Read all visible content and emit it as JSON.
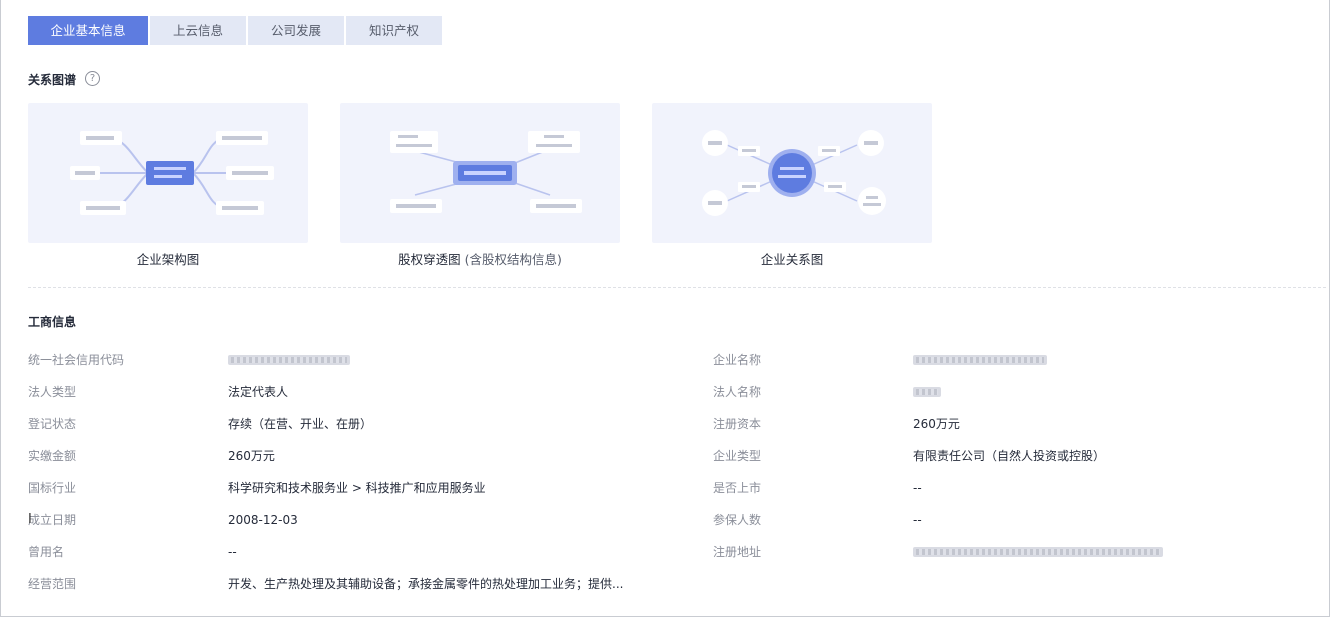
{
  "tabs": [
    {
      "label": "企业基本信息",
      "active": true
    },
    {
      "label": "上云信息",
      "active": false
    },
    {
      "label": "公司发展",
      "active": false
    },
    {
      "label": "知识产权",
      "active": false
    }
  ],
  "relation_section": {
    "title": "关系图谱",
    "help_icon": "?"
  },
  "cards": [
    {
      "caption": "企业架构图",
      "sub": ""
    },
    {
      "caption": "股权穿透图",
      "sub": "(含股权结构信息)"
    },
    {
      "caption": "企业关系图",
      "sub": ""
    }
  ],
  "business_section": {
    "title": "工商信息"
  },
  "left_fields": [
    {
      "label": "统一社会信用代码",
      "value": "",
      "redacted": true
    },
    {
      "label": "法人类型",
      "value": "法定代表人"
    },
    {
      "label": "登记状态",
      "value": "存续（在营、开业、在册）"
    },
    {
      "label": "实缴金额",
      "value": "260万元"
    },
    {
      "label": "国标行业",
      "value": "科学研究和技术服务业 > 科技推广和应用服务业"
    },
    {
      "label": "成立日期",
      "value": "2008-12-03"
    },
    {
      "label": "曾用名",
      "value": "--"
    },
    {
      "label": "经营范围",
      "value": "开发、生产热处理及其辅助设备；承接金属零件的热处理加工业务；提供..."
    }
  ],
  "right_fields": [
    {
      "label": "企业名称",
      "value": "",
      "redacted": true
    },
    {
      "label": "法人名称",
      "value": "",
      "redacted": true
    },
    {
      "label": "注册资本",
      "value": "260万元"
    },
    {
      "label": "企业类型",
      "value": "有限责任公司（自然人投资或控股）"
    },
    {
      "label": "是否上市",
      "value": "--"
    },
    {
      "label": "参保人数",
      "value": "--"
    },
    {
      "label": "注册地址",
      "value": "",
      "redacted": true
    }
  ],
  "colors": {
    "accent": "#5e7ce0",
    "tab_bg": "#e3e8f5",
    "thumb_bg": "#f1f3fc"
  }
}
